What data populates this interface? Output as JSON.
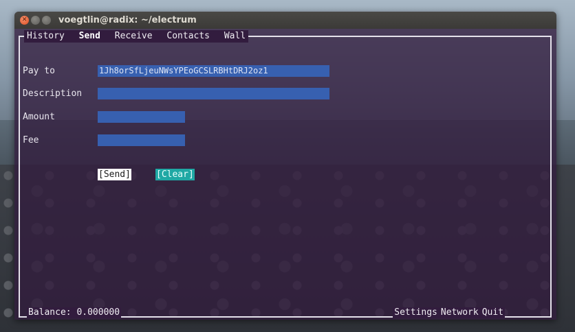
{
  "window": {
    "title": "voegtlin@radix: ~/electrum"
  },
  "tabs": [
    {
      "label": "History",
      "active": false
    },
    {
      "label": "Send",
      "active": true
    },
    {
      "label": "Receive",
      "active": false
    },
    {
      "label": "Contacts",
      "active": false
    },
    {
      "label": "Wall",
      "active": false
    }
  ],
  "form": {
    "pay_to": {
      "label": "Pay to",
      "value": "1Jh8orSfLjeuNWsYPEoGCSLRBHtDRJ2oz1"
    },
    "description": {
      "label": "Description",
      "value": ""
    },
    "amount": {
      "label": "Amount",
      "value": ""
    },
    "fee": {
      "label": "Fee",
      "value": ""
    }
  },
  "buttons": {
    "send": "[Send]",
    "clear": "[Clear]"
  },
  "status": {
    "balance": "Balance: 0.000000",
    "settings": "Settings",
    "network": "Network",
    "quit": "Quit"
  },
  "colors": {
    "terminal_bg": "#321c3e",
    "field_bg": "#3760b0",
    "clear_bg": "#1fa8a4",
    "close_button": "#dd4d22"
  }
}
